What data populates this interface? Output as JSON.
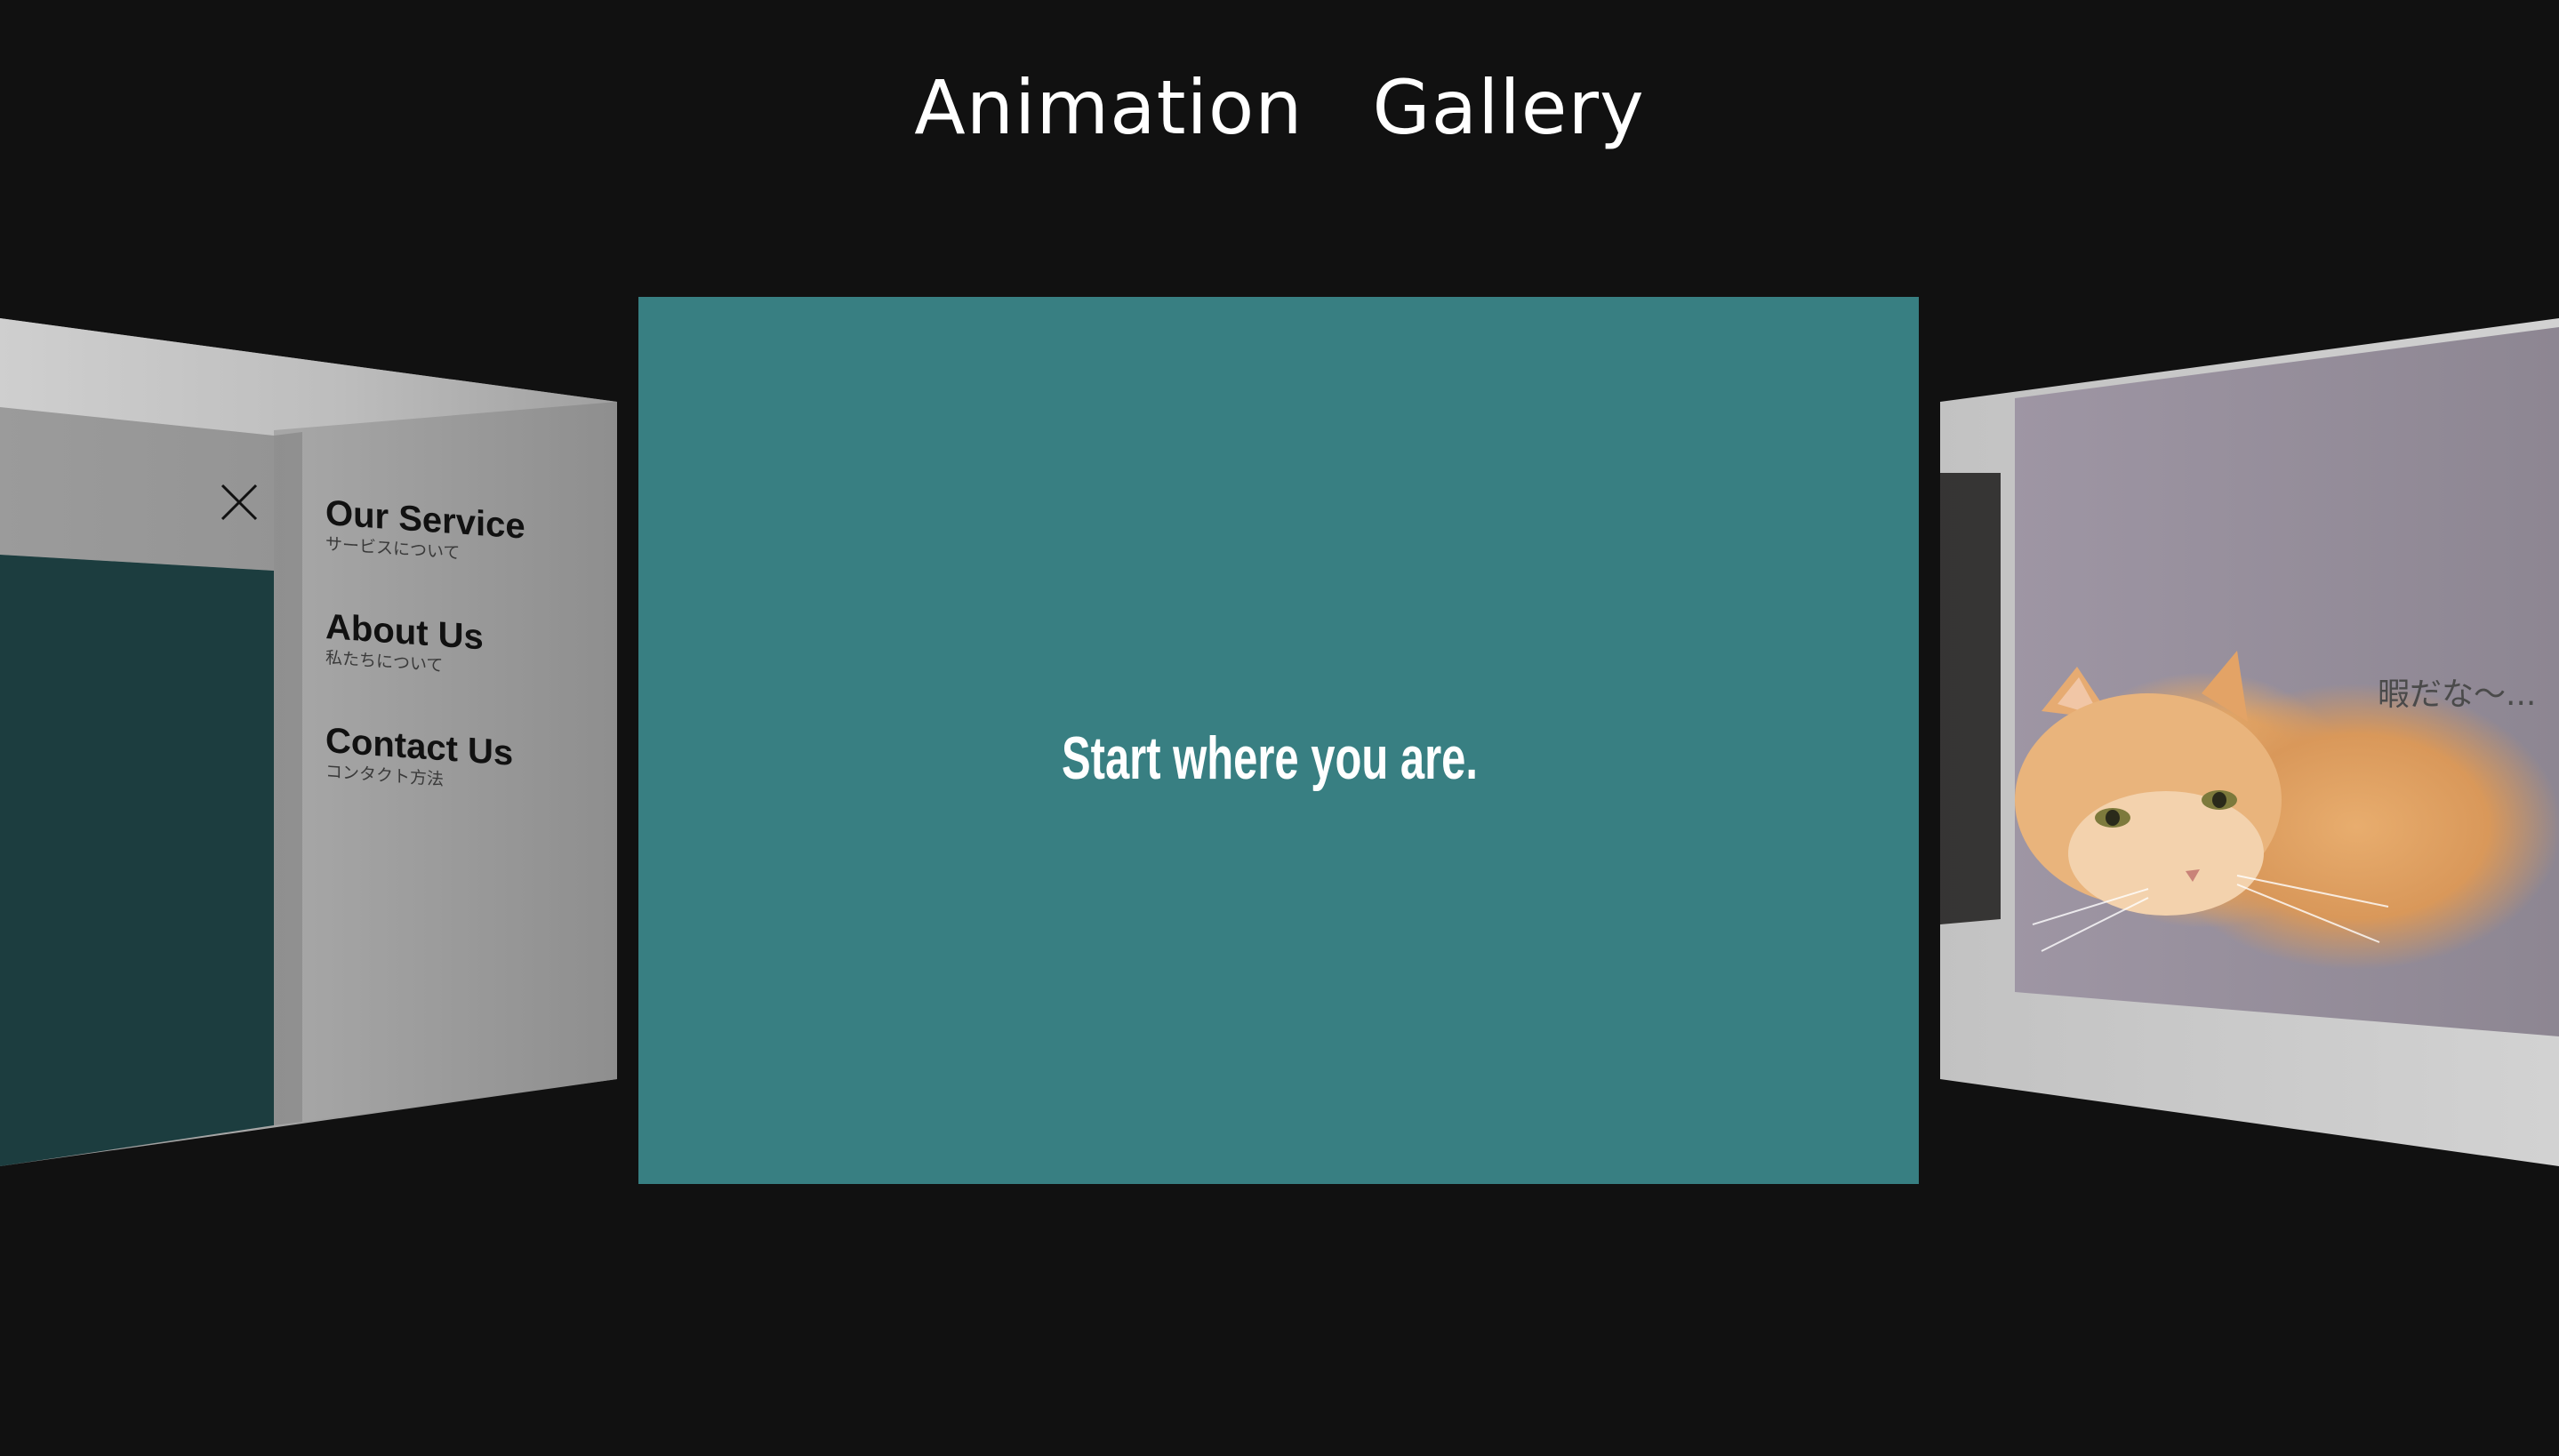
{
  "page": {
    "title_words": [
      "Animation",
      "Gallery"
    ]
  },
  "colors": {
    "background": "#111111",
    "center_slide": "#387f82",
    "left_teal": "#1c3d3f",
    "title_text": "#ffffff"
  },
  "center_slide": {
    "tagline": "Start where you are."
  },
  "left_slide": {
    "close_icon": "close-icon",
    "menu": [
      {
        "label": "Our Service",
        "sub": "サービスについて"
      },
      {
        "label": "About Us",
        "sub": "私たちについて"
      },
      {
        "label": "Contact Us",
        "sub": "コンタクト方法"
      }
    ]
  },
  "right_slide": {
    "caption": "暇だな〜..."
  }
}
